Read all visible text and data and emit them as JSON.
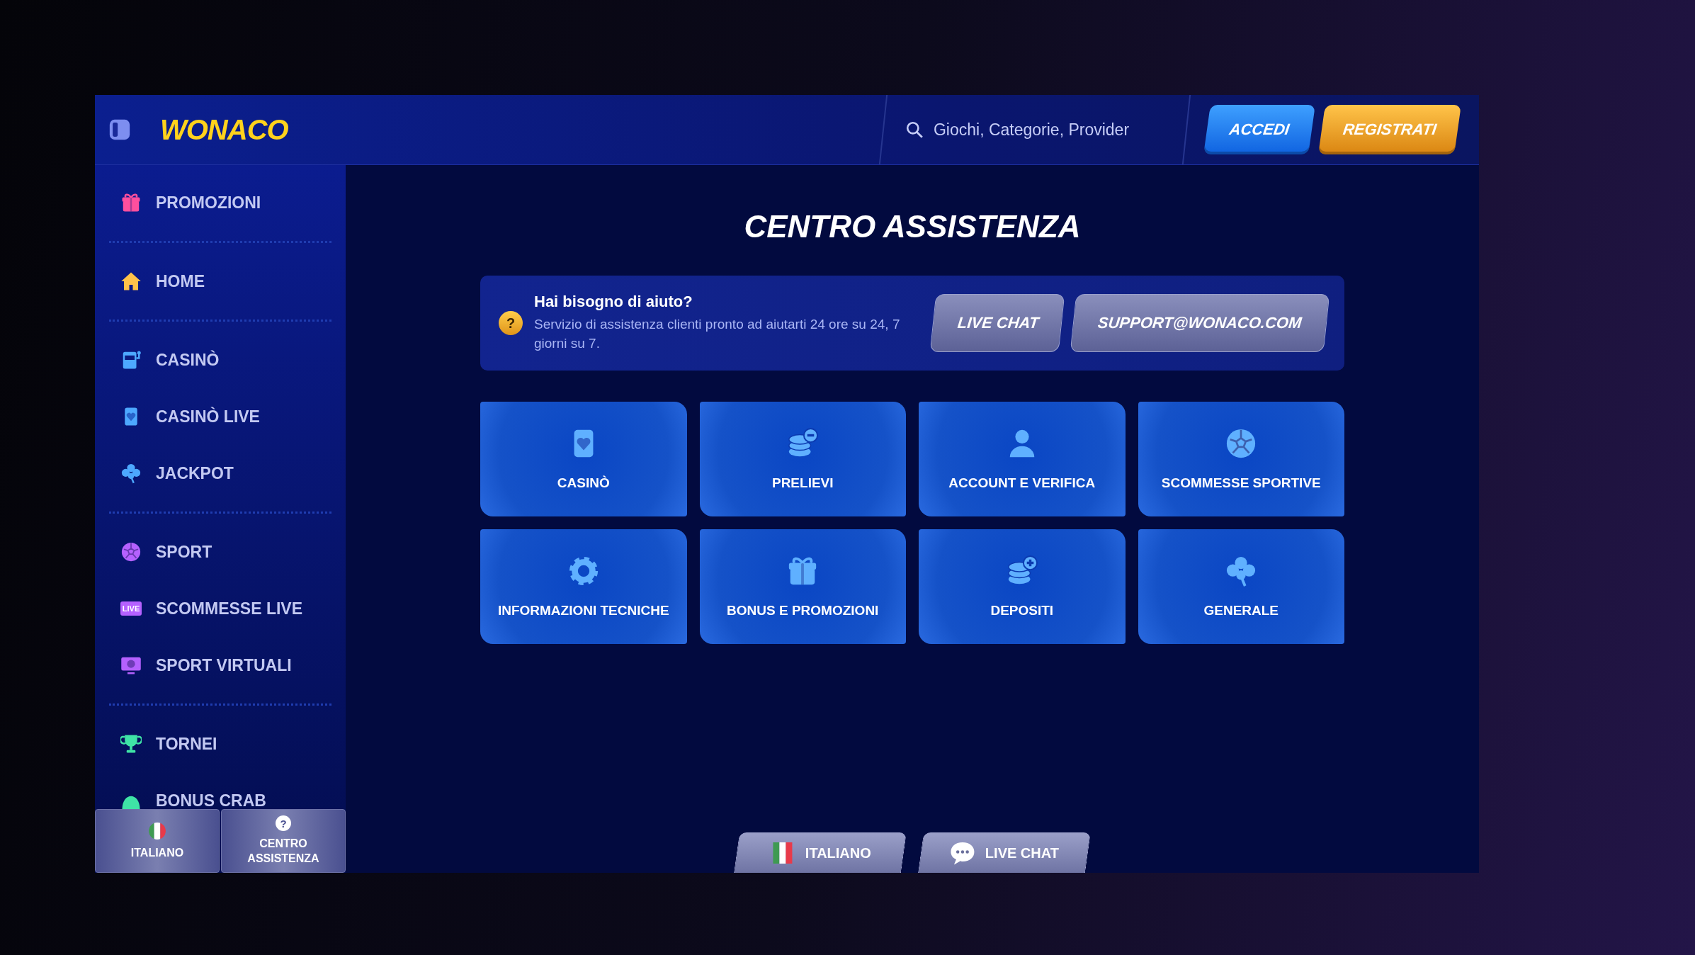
{
  "header": {
    "logo": "WONACO",
    "search": {
      "placeholder": "Giochi, Categorie, Provider"
    },
    "buttons": [
      {
        "label": "ACCEDI",
        "kind": "primary"
      },
      {
        "label": "REGISTRATI",
        "kind": "accent"
      }
    ]
  },
  "sidebar": {
    "groups": [
      {
        "items": [
          {
            "label": "PROMOZIONI"
          }
        ]
      },
      {
        "items": [
          {
            "label": "HOME"
          }
        ]
      },
      {
        "items": [
          {
            "label": "CASINÒ"
          },
          {
            "label": "CASINÒ LIVE"
          },
          {
            "label": "JACKPOT"
          }
        ]
      },
      {
        "items": [
          {
            "label": "SPORT"
          },
          {
            "label": "SCOMMESSE LIVE",
            "badge": "LIVE"
          },
          {
            "label": "SPORT VIRTUALI"
          }
        ]
      },
      {
        "items": [
          {
            "label": "TORNEI"
          },
          {
            "label": "BONUS CRAB"
          }
        ]
      }
    ],
    "footer": [
      {
        "label": "ITALIANO"
      },
      {
        "label": "CENTRO ASSISTENZA",
        "icon_char": "?"
      }
    ]
  },
  "main": {
    "title": "CENTRO ASSISTENZA",
    "help_banner": {
      "icon_char": "?",
      "heading": "Hai bisogno di aiuto?",
      "text": "Servizio di assistenza clienti pronto ad aiutarti 24 ore su 24, 7 giorni su 7.",
      "buttons": [
        "LIVE CHAT",
        "SUPPORT@WONACO.COM"
      ]
    },
    "categories": [
      {
        "label": "CASINÒ"
      },
      {
        "label": "PRELIEVI"
      },
      {
        "label": "ACCOUNT E VERIFICA"
      },
      {
        "label": "SCOMMESSE SPORTIVE"
      },
      {
        "label": "INFORMAZIONI TECNICHE"
      },
      {
        "label": "BONUS E PROMOZIONI"
      },
      {
        "label": "DEPOSITI"
      },
      {
        "label": "GENERALE"
      }
    ],
    "bottom_tabs": [
      {
        "label": "ITALIANO"
      },
      {
        "label": "LIVE CHAT"
      }
    ]
  }
}
